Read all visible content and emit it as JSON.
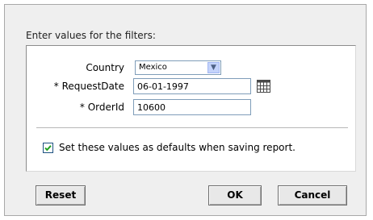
{
  "dialog": {
    "heading": "Enter values for the filters:",
    "fields": {
      "country_label": "Country",
      "country_value": "Mexico",
      "request_date_label": "* RequestDate",
      "request_date_value": "06-01-1997",
      "order_id_label": "* OrderId",
      "order_id_value": "10600"
    },
    "defaults_checkbox": {
      "checked": true,
      "label": "Set these values as defaults when saving report."
    },
    "buttons": {
      "reset": "Reset",
      "ok": "OK",
      "cancel": "Cancel"
    }
  },
  "icons": {
    "dropdown": "chevron-down-icon",
    "calendar": "calendar-icon",
    "check": "checkmark-icon"
  }
}
